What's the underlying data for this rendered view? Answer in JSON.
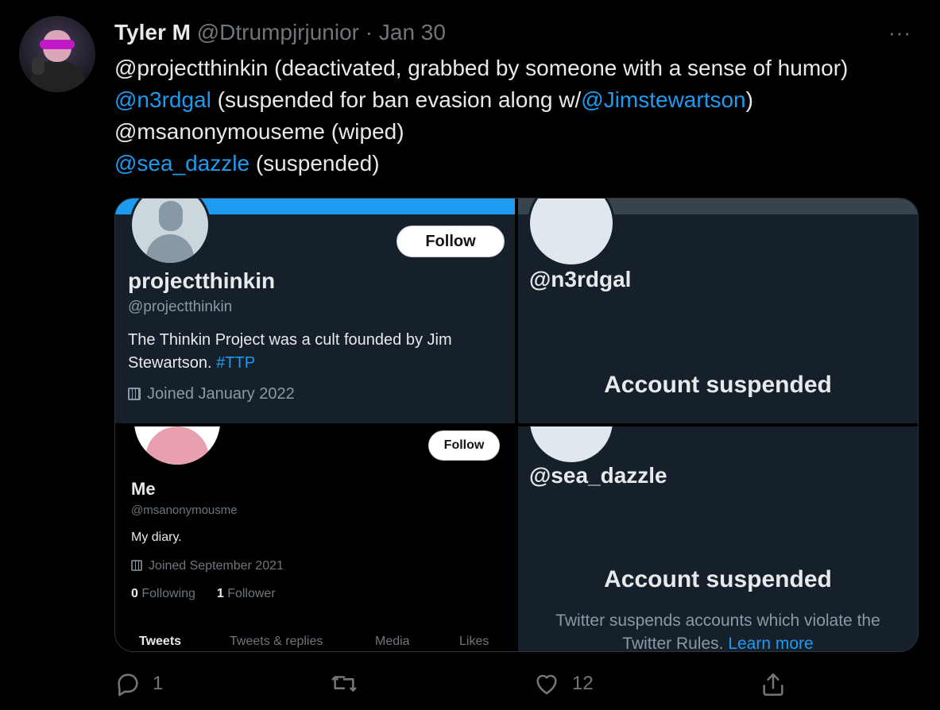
{
  "author": {
    "name": "Tyler M",
    "handle": "@Dtrumpjrjunior",
    "separator": "·",
    "date": "Jan 30"
  },
  "more_label": "···",
  "tweet": {
    "line1": "@projectthinkin (deactivated, grabbed by someone with a sense of humor)",
    "line2_link1": "@n3rdgal",
    "line2_text": " (suspended for ban evasion along w/",
    "line2_link2": "@Jimstewartson",
    "line2_end": ")",
    "line3": "@msanonymouseme (wiped)",
    "line4_link": "@sea_dazzle",
    "line4_text": " (suspended)"
  },
  "media": {
    "panel1": {
      "follow": "Follow",
      "name": "projectthinkin",
      "handle": "@projectthinkin",
      "bio_text": "The Thinkin Project was a cult founded by Jim Stewartson. ",
      "bio_tag": "#TTP",
      "joined": "Joined January 2022"
    },
    "panel2": {
      "handle": "@n3rdgal",
      "title": "Account suspended"
    },
    "panel3": {
      "follow": "Follow",
      "name": "Me",
      "handle": "@msanonymousme",
      "bio": "My diary.",
      "joined": "Joined September 2021",
      "following_count": "0",
      "following_label": " Following",
      "followers_count": "1",
      "followers_label": " Follower",
      "tabs": [
        "Tweets",
        "Tweets & replies",
        "Media",
        "Likes"
      ]
    },
    "panel4": {
      "handle": "@sea_dazzle",
      "title": "Account suspended",
      "text": "Twitter suspends accounts which violate the Twitter Rules. ",
      "learn_more": "Learn more"
    }
  },
  "actions": {
    "reply_count": "1",
    "retweet_count": "",
    "like_count": "12"
  },
  "colors": {
    "accent": "#1d9bf0",
    "dim_bg": "#15202b",
    "muted": "#71767b"
  }
}
